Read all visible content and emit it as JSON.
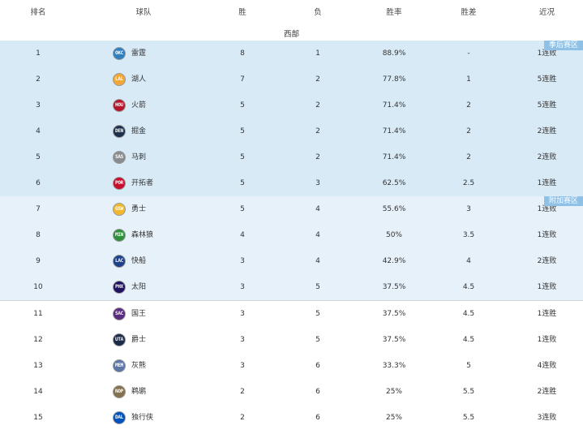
{
  "header": {
    "rank": "排名",
    "team": "球队",
    "wins": "胜",
    "losses": "负",
    "pct": "胜率",
    "gb": "胜差",
    "streak": "近况"
  },
  "conference": "西部",
  "tags": {
    "playoff": "季后赛区",
    "playin": "附加赛区"
  },
  "rows": [
    {
      "rank": "1",
      "team": "雷霆",
      "abbr": "OKC",
      "color": "#2f7fc1",
      "w": "8",
      "l": "1",
      "pct": "88.9%",
      "gb": "-",
      "streak": "1连败",
      "zone": "playoff"
    },
    {
      "rank": "2",
      "team": "湖人",
      "abbr": "LAL",
      "color": "#f3a735",
      "w": "7",
      "l": "2",
      "pct": "77.8%",
      "gb": "1",
      "streak": "5连胜",
      "zone": "playoff"
    },
    {
      "rank": "3",
      "team": "火箭",
      "abbr": "HOU",
      "color": "#b5162b",
      "w": "5",
      "l": "2",
      "pct": "71.4%",
      "gb": "2",
      "streak": "5连胜",
      "zone": "playoff"
    },
    {
      "rank": "4",
      "team": "掘金",
      "abbr": "DEN",
      "color": "#1d2f4a",
      "w": "5",
      "l": "2",
      "pct": "71.4%",
      "gb": "2",
      "streak": "2连胜",
      "zone": "playoff"
    },
    {
      "rank": "5",
      "team": "马刺",
      "abbr": "SAS",
      "color": "#8a8d8f",
      "w": "5",
      "l": "2",
      "pct": "71.4%",
      "gb": "2",
      "streak": "2连败",
      "zone": "playoff"
    },
    {
      "rank": "6",
      "team": "开拓者",
      "abbr": "POR",
      "color": "#c8102e",
      "w": "5",
      "l": "3",
      "pct": "62.5%",
      "gb": "2.5",
      "streak": "1连胜",
      "zone": "playoff"
    },
    {
      "rank": "7",
      "team": "勇士",
      "abbr": "GSW",
      "color": "#f1b82d",
      "w": "5",
      "l": "4",
      "pct": "55.6%",
      "gb": "3",
      "streak": "1连败",
      "zone": "playin"
    },
    {
      "rank": "8",
      "team": "森林狼",
      "abbr": "MIN",
      "color": "#2f8f3a",
      "w": "4",
      "l": "4",
      "pct": "50%",
      "gb": "3.5",
      "streak": "1连败",
      "zone": "playin"
    },
    {
      "rank": "9",
      "team": "快船",
      "abbr": "LAC",
      "color": "#1d428a",
      "w": "3",
      "l": "4",
      "pct": "42.9%",
      "gb": "4",
      "streak": "2连败",
      "zone": "playin"
    },
    {
      "rank": "10",
      "team": "太阳",
      "abbr": "PHX",
      "color": "#1d1160",
      "w": "3",
      "l": "5",
      "pct": "37.5%",
      "gb": "4.5",
      "streak": "1连败",
      "zone": "playin"
    },
    {
      "rank": "11",
      "team": "国王",
      "abbr": "SAC",
      "color": "#5a2d81",
      "w": "3",
      "l": "5",
      "pct": "37.5%",
      "gb": "4.5",
      "streak": "1连胜",
      "zone": "normal"
    },
    {
      "rank": "12",
      "team": "爵士",
      "abbr": "UTA",
      "color": "#1c2b4a",
      "w": "3",
      "l": "5",
      "pct": "37.5%",
      "gb": "4.5",
      "streak": "1连败",
      "zone": "normal"
    },
    {
      "rank": "13",
      "team": "灰熊",
      "abbr": "MEM",
      "color": "#5d76a9",
      "w": "3",
      "l": "6",
      "pct": "33.3%",
      "gb": "5",
      "streak": "4连败",
      "zone": "normal"
    },
    {
      "rank": "14",
      "team": "鹈鹕",
      "abbr": "NOP",
      "color": "#85714d",
      "w": "2",
      "l": "6",
      "pct": "25%",
      "gb": "5.5",
      "streak": "2连胜",
      "zone": "normal"
    },
    {
      "rank": "15",
      "team": "独行侠",
      "abbr": "DAL",
      "color": "#0053bc",
      "w": "2",
      "l": "6",
      "pct": "25%",
      "gb": "5.5",
      "streak": "3连败",
      "zone": "normal"
    }
  ]
}
